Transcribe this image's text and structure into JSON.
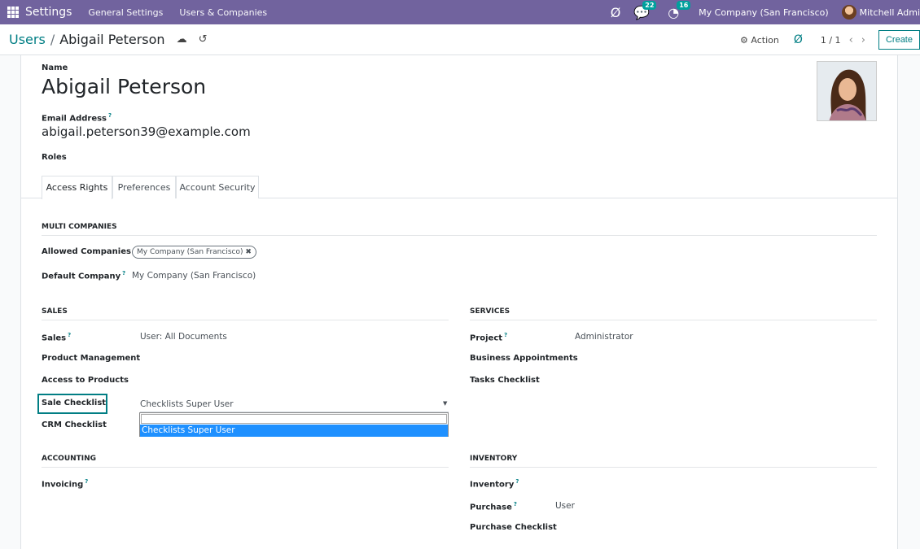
{
  "navbar": {
    "app_name": "Settings",
    "menu": [
      "General Settings",
      "Users & Companies"
    ],
    "messages_count": "22",
    "activities_count": "16",
    "company": "My Company (San Francisco)",
    "user": "Mitchell Admi"
  },
  "control": {
    "breadcrumb_parent": "Users",
    "breadcrumb_sep": "/",
    "breadcrumb_current": "Abigail Peterson",
    "action_label": "Action",
    "pager": "1 / 1",
    "create_label": "Create"
  },
  "form": {
    "name_label": "Name",
    "name_value": "Abigail Peterson",
    "email_label": "Email Address",
    "email_value": "abigail.peterson39@example.com",
    "roles_label": "Roles",
    "help_mark": "?"
  },
  "tabs": [
    "Access Rights",
    "Preferences",
    "Account Security"
  ],
  "multi_companies": {
    "title": "MULTI COMPANIES",
    "allowed_label": "Allowed Companies",
    "allowed_tag": "My Company (San Francisco)",
    "default_label": "Default Company",
    "default_value": "My Company (San Francisco)"
  },
  "sales": {
    "title": "SALES",
    "sales_label": "Sales",
    "sales_value": "User: All Documents",
    "product_mgmt_label": "Product Management",
    "access_products_label": "Access to Products",
    "sale_checklist_label": "Sale Checklist",
    "sale_checklist_value": "Checklists Super User",
    "crm_checklist_label": "CRM Checklist"
  },
  "dropdown": {
    "options": [
      "Checklists Super User"
    ]
  },
  "services": {
    "title": "SERVICES",
    "project_label": "Project",
    "project_value": "Administrator",
    "business_appt_label": "Business Appointments",
    "tasks_checklist_label": "Tasks Checklist"
  },
  "accounting": {
    "title": "ACCOUNTING",
    "invoicing_label": "Invoicing"
  },
  "inventory": {
    "title": "INVENTORY",
    "inventory_label": "Inventory",
    "purchase_label": "Purchase",
    "purchase_value": "User",
    "purchase_checklist_label": "Purchase Checklist"
  },
  "colors": {
    "navbar": "#71639e",
    "accent": "#017e84",
    "dropdown_highlight": "#1e90ff"
  }
}
